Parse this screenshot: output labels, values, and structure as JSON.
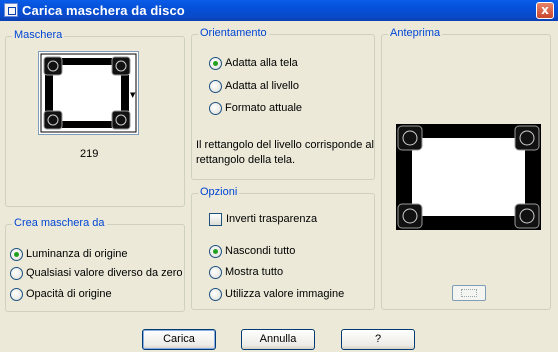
{
  "window": {
    "title": "Carica maschera da disco",
    "close_glyph": "x"
  },
  "mask": {
    "legend": "Maschera",
    "value": "219",
    "icon": "celtic-frame-mask"
  },
  "create_from": {
    "legend": "Crea maschera da",
    "options": [
      {
        "label": "Luminanza di origine",
        "checked": true
      },
      {
        "label": "Qualsiasi valore diverso da zero",
        "checked": false
      },
      {
        "label": "Opacità di origine",
        "checked": false
      }
    ]
  },
  "orientation": {
    "legend": "Orientamento",
    "options": [
      {
        "label": "Adatta alla tela",
        "checked": true
      },
      {
        "label": "Adatta al livello",
        "checked": false
      },
      {
        "label": "Formato attuale",
        "checked": false
      }
    ],
    "description": [
      "Il rettangolo del livello corrisponde al",
      "rettangolo della tela."
    ]
  },
  "options": {
    "legend": "Opzioni",
    "invert_label": "Inverti trasparenza",
    "invert_checked": false,
    "radios": [
      {
        "label": "Nascondi tutto",
        "checked": true
      },
      {
        "label": "Mostra tutto",
        "checked": false
      },
      {
        "label": "Utilizza valore immagine",
        "checked": false
      }
    ]
  },
  "preview": {
    "legend": "Anteprima"
  },
  "buttons": {
    "load": "Carica",
    "cancel": "Annulla",
    "help": "?"
  },
  "colors": {
    "titlebar": "#0a5ce8",
    "legend": "#0046d5",
    "dialog_bg": "#ece9d8",
    "radio_dot": "#21a121"
  }
}
